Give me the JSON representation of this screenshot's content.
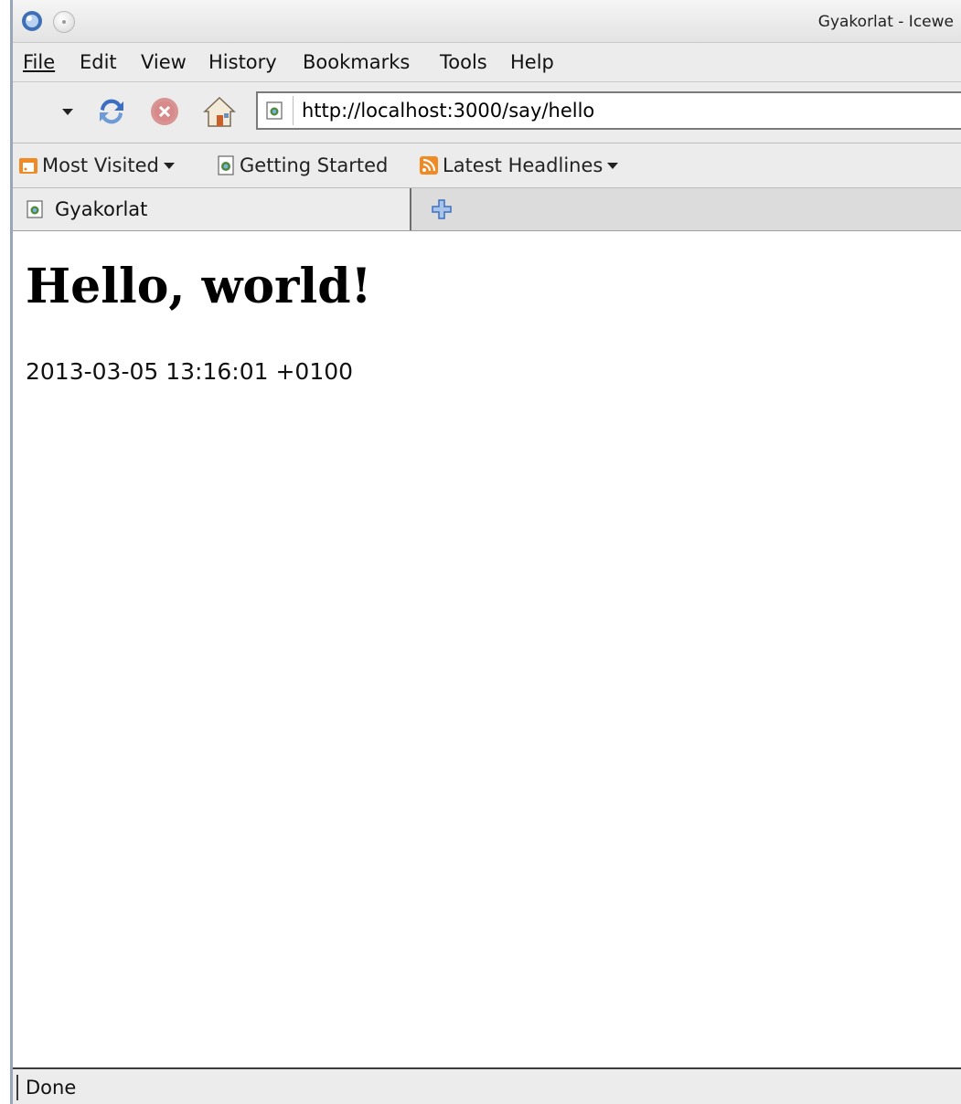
{
  "window": {
    "title": "Gyakorlat - Icewe"
  },
  "menu": {
    "file": "File",
    "edit": "Edit",
    "view": "View",
    "history": "History",
    "bookmarks": "Bookmarks",
    "tools": "Tools",
    "help": "Help"
  },
  "navigation": {
    "url": "http://localhost:3000/say/hello"
  },
  "bookmarks_toolbar": {
    "most_visited": "Most Visited",
    "getting_started": "Getting Started",
    "latest_headlines": "Latest Headlines"
  },
  "tabs": [
    {
      "label": "Gyakorlat"
    }
  ],
  "page": {
    "heading": "Hello, world!",
    "timestamp": "2013-03-05 13:16:01 +0100"
  },
  "status": {
    "text": "Done"
  },
  "colors": {
    "feed_orange": "#f08a24",
    "reload_blue": "#3b6fc4",
    "stop_red": "#c94a4a"
  }
}
